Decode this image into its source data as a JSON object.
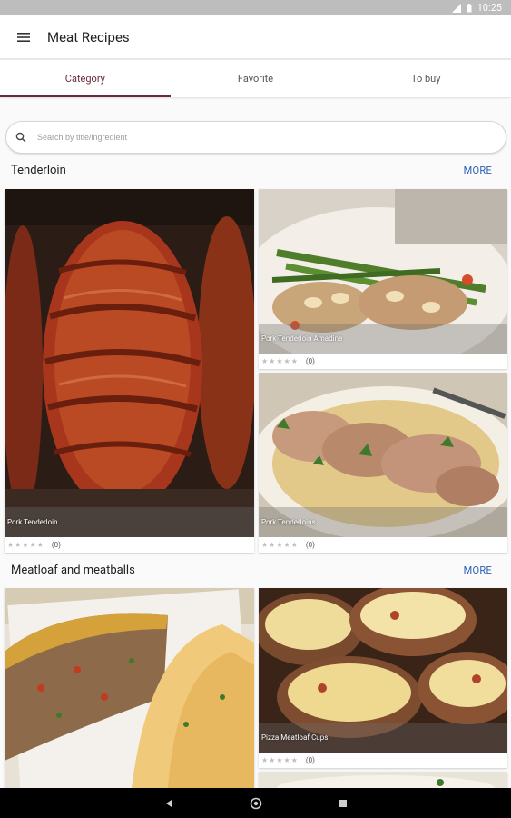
{
  "status_bar": {
    "time": "10:25"
  },
  "toolbar": {
    "title": "Meat Recipes",
    "menu_icon": "menu-icon"
  },
  "tabs": [
    {
      "label": "Category",
      "active": true
    },
    {
      "label": "Favorite",
      "active": false
    },
    {
      "label": "To buy",
      "active": false
    }
  ],
  "search": {
    "placeholder": "Search by title/ingredient",
    "value": ""
  },
  "sections": [
    {
      "title": "Tenderloin",
      "more_label": "MORE",
      "recipes": [
        {
          "title": "Pork Tenderloin",
          "rating_count": "(0)"
        },
        {
          "title": "Pork Tenderloin Amadine",
          "rating_count": "(0)"
        },
        {
          "title": "Pork Tenderloins",
          "rating_count": "(0)"
        }
      ]
    },
    {
      "title": "Meatloaf and meatballs",
      "more_label": "MORE",
      "recipes": [
        {
          "title": "",
          "rating_count": ""
        },
        {
          "title": "Pizza Meatloaf Cups",
          "rating_count": "(0)"
        }
      ]
    }
  ],
  "colors": {
    "accent": "#6b2a38",
    "link": "#2a5fb0",
    "status_bar": "#bdbdbd",
    "nav_bar": "#000000"
  }
}
